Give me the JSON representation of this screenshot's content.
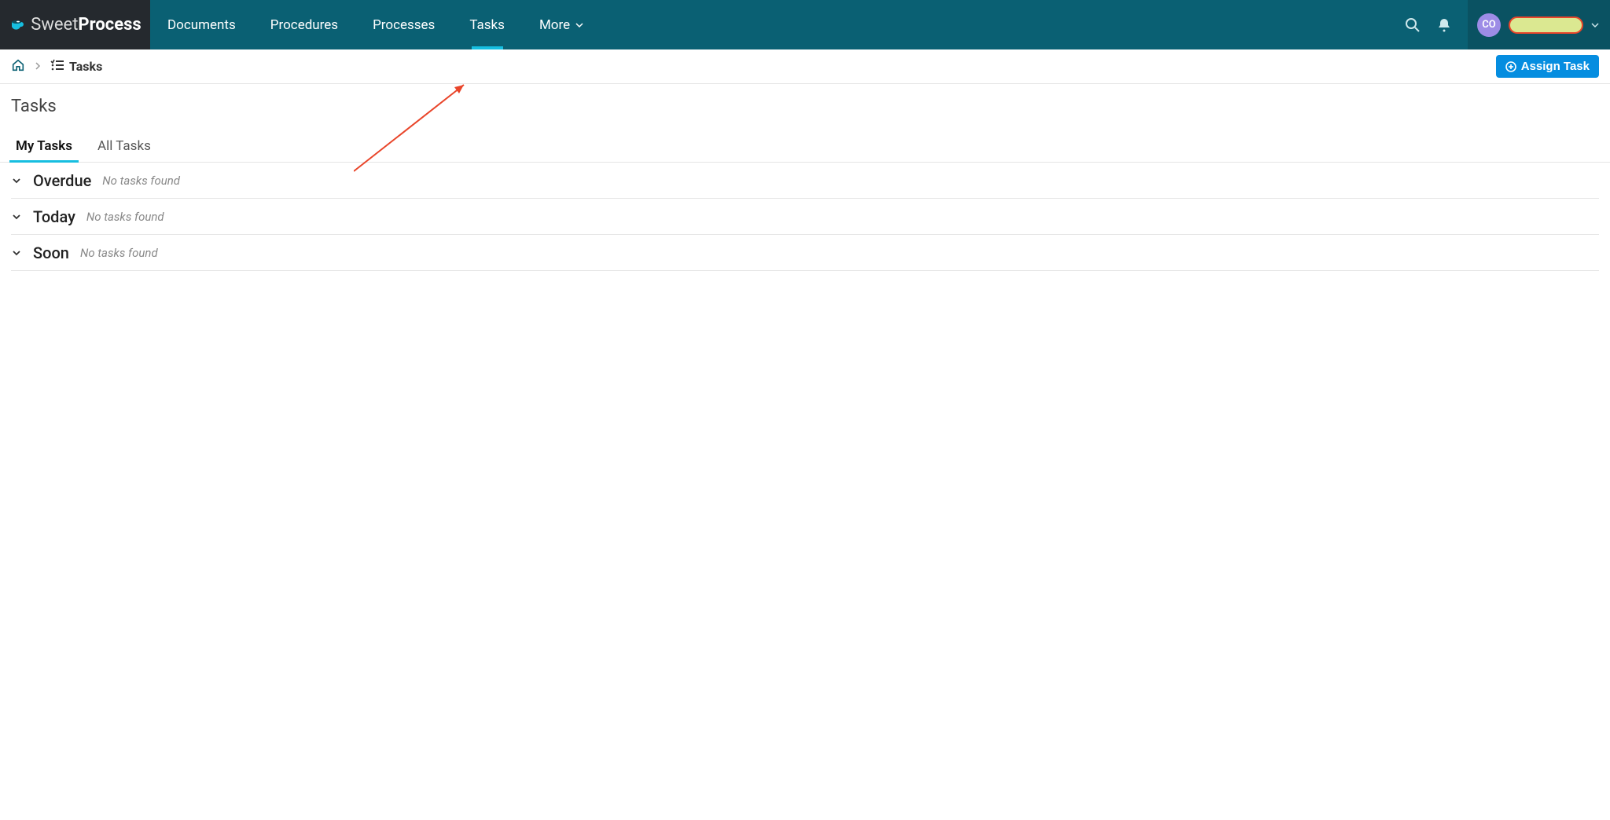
{
  "brand": {
    "sweet": "Sweet",
    "process": "Process"
  },
  "nav": {
    "documents": "Documents",
    "procedures": "Procedures",
    "processes": "Processes",
    "tasks": "Tasks",
    "more": "More"
  },
  "user": {
    "initials": "CO"
  },
  "breadcrumb": {
    "tasks": "Tasks"
  },
  "assign_button": "Assign Task",
  "page_title": "Tasks",
  "tabs": {
    "my_tasks": "My Tasks",
    "all_tasks": "All Tasks"
  },
  "sections": [
    {
      "title": "Overdue",
      "empty": "No tasks found"
    },
    {
      "title": "Today",
      "empty": "No tasks found"
    },
    {
      "title": "Soon",
      "empty": "No tasks found"
    }
  ]
}
